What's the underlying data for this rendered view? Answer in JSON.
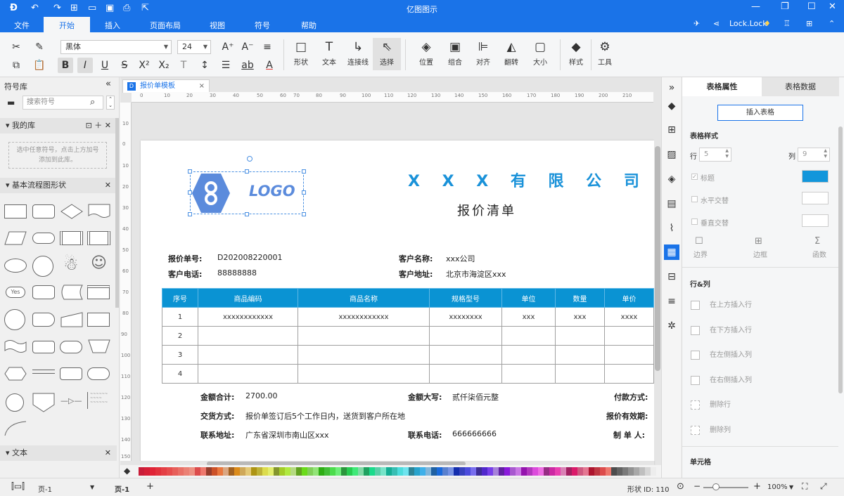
{
  "app": {
    "title": "亿图图示"
  },
  "menu": {
    "items": [
      "文件",
      "开始",
      "插入",
      "页面布局",
      "视图",
      "符号",
      "帮助"
    ],
    "user": "Lock.Lock"
  },
  "toolbar": {
    "font_name": "黑体",
    "font_size": "24",
    "big_buttons": [
      "形状",
      "文本",
      "连接线",
      "选择",
      "位置",
      "组合",
      "对齐",
      "翻转",
      "大小",
      "样式",
      "工具"
    ]
  },
  "left_panel": {
    "title": "符号库",
    "search_placeholder": "搜索符号",
    "my_library": "我的库",
    "my_library_hint": "选中任意符号，点击上方加号添加到此库。",
    "basic_flow": "基本流程图形状",
    "text_section": "文本",
    "yes_label": "Yes"
  },
  "canvas": {
    "tab_name": "报价单模板",
    "ruler_h": [
      "0",
      "10",
      "20",
      "30",
      "40",
      "50",
      "60",
      "70",
      "80",
      "90",
      "100",
      "110",
      "120",
      "130",
      "140",
      "150",
      "160",
      "170",
      "180",
      "190",
      "200",
      "210"
    ],
    "ruler_v": [
      "10",
      "0",
      "10",
      "20",
      "30",
      "40",
      "50",
      "60",
      "70",
      "80",
      "90",
      "100",
      "110",
      "120",
      "130",
      "140",
      "150"
    ]
  },
  "document": {
    "logo_text": "LOGO",
    "company": "X X X 有 限 公 司",
    "subtitle": "报价清单",
    "quote_no_label": "报价单号:",
    "quote_no": "D202008220001",
    "customer_name_label": "客户名称:",
    "customer_name": "xxx公司",
    "customer_phone_label": "客户电话:",
    "customer_phone": "88888888",
    "customer_addr_label": "客户地址:",
    "customer_addr": "北京市海淀区xxx",
    "table": {
      "headers": [
        "序号",
        "商品编码",
        "商品名称",
        "规格型号",
        "单位",
        "数量",
        "单价"
      ],
      "rows": [
        [
          "1",
          "xxxxxxxxxxxx",
          "xxxxxxxxxxxx",
          "xxxxxxxx",
          "xxx",
          "xxx",
          "xxxx"
        ],
        [
          "2",
          "",
          "",
          "",
          "",
          "",
          ""
        ],
        [
          "3",
          "",
          "",
          "",
          "",
          "",
          ""
        ],
        [
          "4",
          "",
          "",
          "",
          "",
          "",
          ""
        ]
      ]
    },
    "total_label": "金额合计:",
    "total": "2700.00",
    "total_cn_label": "金额大写:",
    "total_cn": "贰仟柒佰元整",
    "pay_label": "付款方式:",
    "delivery_label": "交货方式:",
    "delivery": "报价单签订后5个工作日内，送货到客户所在地",
    "valid_label": "报价有效期:",
    "contact_addr_label": "联系地址:",
    "contact_addr": "广东省深圳市南山区xxx",
    "contact_phone_label": "联系电话:",
    "contact_phone": "666666666",
    "maker_label": "制 单 人:"
  },
  "right_panel": {
    "tab_props": "表格属性",
    "tab_data": "表格数据",
    "insert_table": "插入表格",
    "table_style": "表格样式",
    "row_label": "行",
    "row_value": "5",
    "col_label": "列",
    "col_value": "9",
    "title_label": "标题",
    "title_color": "#1296db",
    "h_alt": "水平交替",
    "v_alt": "垂直交替",
    "border": "边界",
    "frame": "边框",
    "function": "函数",
    "rows_cols": "行&列",
    "insert_above": "在上方插入行",
    "insert_below": "在下方插入行",
    "insert_left": "在左侧插入列",
    "insert_right": "在右侧插入列",
    "delete_row": "删除行",
    "delete_col": "删除列",
    "cell": "单元格"
  },
  "status": {
    "page_dropdown": "页-1",
    "page_tab": "页-1",
    "shape_id": "形状 ID:  110",
    "zoom": "100%"
  }
}
